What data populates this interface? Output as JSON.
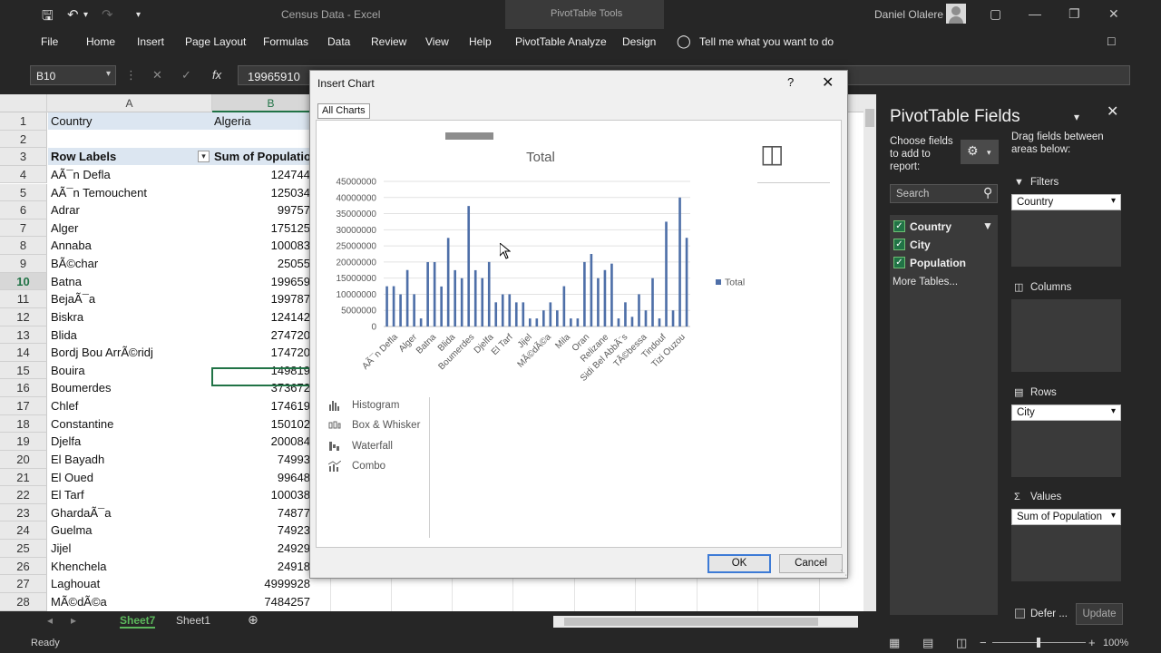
{
  "titlebar": {
    "doc_title": "Census Data  -  Excel",
    "tools_label": "PivotTable Tools",
    "user": "Daniel Olalere"
  },
  "ribbon": {
    "tabs": [
      "File",
      "Home",
      "Insert",
      "Page Layout",
      "Formulas",
      "Data",
      "Review",
      "View",
      "Help",
      "PivotTable Analyze",
      "Design"
    ],
    "tell_me": "Tell me what you want to do"
  },
  "formula_bar": {
    "name_box": "B10",
    "formula": "19965910"
  },
  "grid": {
    "col_a": "A",
    "col_b": "B",
    "rows": [
      {
        "n": "1",
        "a": "Country",
        "b": "Algeria"
      },
      {
        "n": "2",
        "a": "",
        "b": ""
      },
      {
        "n": "3",
        "a": "Row Labels",
        "b": "Sum of Populatio"
      },
      {
        "n": "4",
        "a": "AÃ¯n Defla",
        "b": "124744"
      },
      {
        "n": "5",
        "a": "AÃ¯n Temouchent",
        "b": "125034"
      },
      {
        "n": "6",
        "a": "Adrar",
        "b": "99757"
      },
      {
        "n": "7",
        "a": "Alger",
        "b": "175125"
      },
      {
        "n": "8",
        "a": "Annaba",
        "b": "100083"
      },
      {
        "n": "9",
        "a": "BÃ©char",
        "b": "25055"
      },
      {
        "n": "10",
        "a": "Batna",
        "b": "199659"
      },
      {
        "n": "11",
        "a": "BejaÃ¯a",
        "b": "199787"
      },
      {
        "n": "12",
        "a": "Biskra",
        "b": "124142"
      },
      {
        "n": "13",
        "a": "Blida",
        "b": "274720"
      },
      {
        "n": "14",
        "a": "Bordj Bou ArrÃ©ridj",
        "b": "174720"
      },
      {
        "n": "15",
        "a": "Bouira",
        "b": "149819"
      },
      {
        "n": "16",
        "a": "Boumerdes",
        "b": "373672"
      },
      {
        "n": "17",
        "a": "Chlef",
        "b": "174619"
      },
      {
        "n": "18",
        "a": "Constantine",
        "b": "150102"
      },
      {
        "n": "19",
        "a": "Djelfa",
        "b": "200084"
      },
      {
        "n": "20",
        "a": "El Bayadh",
        "b": "74993"
      },
      {
        "n": "21",
        "a": "El Oued",
        "b": "99648"
      },
      {
        "n": "22",
        "a": "El Tarf",
        "b": "100038"
      },
      {
        "n": "23",
        "a": "GhardaÃ¯a",
        "b": "74877"
      },
      {
        "n": "24",
        "a": "Guelma",
        "b": "74923"
      },
      {
        "n": "25",
        "a": "Jijel",
        "b": "24929"
      },
      {
        "n": "26",
        "a": "Khenchela",
        "b": "24918"
      },
      {
        "n": "27",
        "a": "Laghouat",
        "b": "4999928"
      },
      {
        "n": "28",
        "a": "MÃ©dÃ©a",
        "b": "7484257"
      }
    ]
  },
  "sheets": [
    "Sheet7",
    "Sheet1"
  ],
  "status": {
    "left": "Ready",
    "zoom": "100%"
  },
  "dialog": {
    "title": "Insert Chart",
    "help": "?",
    "tab": "All Charts",
    "chart_types": [
      "Histogram",
      "Box & Whisker",
      "Waterfall",
      "Combo"
    ],
    "ok": "OK",
    "cancel": "Cancel"
  },
  "chart_data": {
    "type": "bar",
    "title": "Total",
    "legend": "Total",
    "legend_position": "right",
    "ylim": [
      0,
      45000000
    ],
    "yticks": [
      "0",
      "5000000",
      "10000000",
      "15000000",
      "20000000",
      "25000000",
      "30000000",
      "35000000",
      "40000000",
      "45000000"
    ],
    "x_labels": [
      "AÃ¯n Defla",
      "Alger",
      "Batna",
      "Blida",
      "Boumerdes",
      "Djelfa",
      "El Tarf",
      "Jijel",
      "MÃ©dÃ©a",
      "Mila",
      "Oran",
      "Relizane",
      "Sidi Bel AbbÃ¨s",
      "TÃ©bessa",
      "Tindouf",
      "Tizi Ouzou"
    ],
    "values": [
      12474400,
      12503400,
      9975700,
      17512500,
      10008300,
      2505500,
      19965910,
      19978700,
      12414200,
      27472000,
      17472000,
      14981900,
      37367200,
      17461900,
      15010200,
      20008400,
      7499300,
      9964800,
      10003800,
      7487700,
      7492300,
      2492900,
      2491800,
      4999928,
      7484257,
      5000000,
      12500000,
      2500000,
      2500000,
      20000000,
      22500000,
      15000000,
      17500000,
      19500000,
      2500000,
      7500000,
      3000000,
      10000000,
      5000000,
      15000000,
      2500000,
      32500000,
      5000000,
      40000000,
      27500000
    ],
    "color": "#4e6fa8"
  },
  "pivot": {
    "title": "PivotTable Fields",
    "choose_label": "Choose fields to add to report:",
    "drag_label": "Drag fields between areas below:",
    "search_placeholder": "Search",
    "fields": [
      "Country",
      "City",
      "Population"
    ],
    "more_tables": "More Tables...",
    "filters_label": "Filters",
    "filters_value": "Country",
    "columns_label": "Columns",
    "rows_label": "Rows",
    "rows_value": "City",
    "values_label": "Values",
    "values_value": "Sum of Population",
    "defer_label": "Defer ...",
    "update_label": "Update"
  }
}
